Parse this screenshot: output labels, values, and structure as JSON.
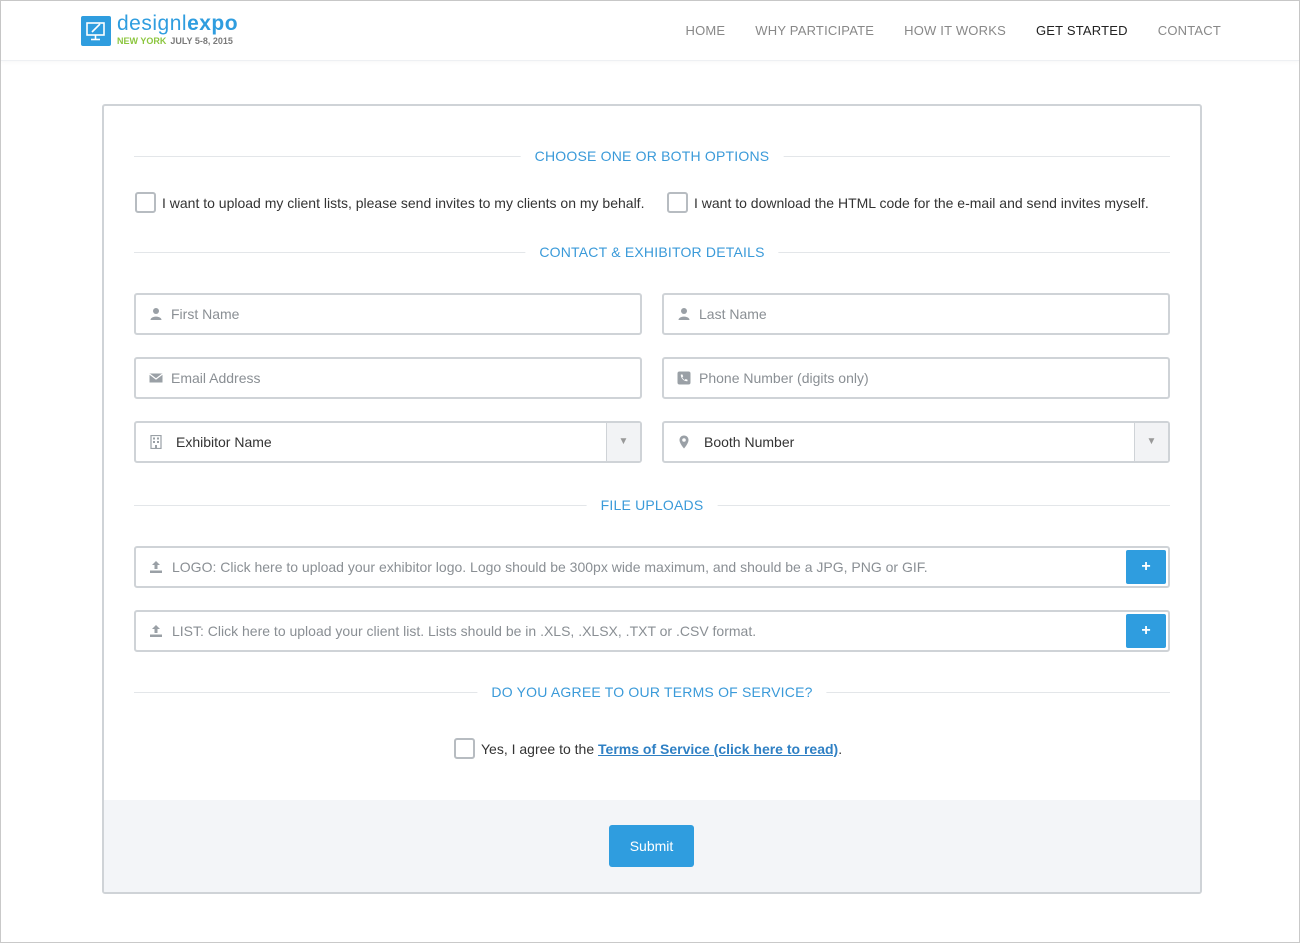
{
  "brand": {
    "name_light": "designl",
    "name_bold": "expo",
    "city": "NEW YORK",
    "dates": "JULY 5-8, 2015",
    "logo_icon": "monitor-pencil-icon",
    "accent_color": "#2f9ddf",
    "city_color": "#8cc63f"
  },
  "nav": {
    "items": [
      {
        "label": "HOME"
      },
      {
        "label": "WHY PARTICIPATE"
      },
      {
        "label": "HOW IT WORKS"
      },
      {
        "label": "GET STARTED",
        "active": true
      },
      {
        "label": "CONTACT"
      }
    ]
  },
  "sections": {
    "options": "CHOOSE ONE OR BOTH OPTIONS",
    "contact": "CONTACT & EXHIBITOR DETAILS",
    "uploads": "FILE UPLOADS",
    "terms": "DO YOU AGREE TO OUR TERMS OF SERVICE?"
  },
  "options": {
    "upload_lists": {
      "label": "I want to upload my client lists, please send invites to my clients on my behalf.",
      "checked": false
    },
    "download_html": {
      "label": "I want to download the HTML code for the e-mail and send invites myself.",
      "checked": false
    }
  },
  "fields": {
    "first_name": {
      "placeholder": "First Name",
      "icon": "user-icon",
      "value": ""
    },
    "last_name": {
      "placeholder": "Last Name",
      "icon": "user-icon",
      "value": ""
    },
    "email": {
      "placeholder": "Email Address",
      "icon": "envelope-icon",
      "value": ""
    },
    "phone": {
      "placeholder": "Phone Number (digits only)",
      "icon": "phone-icon",
      "value": ""
    },
    "exhibitor": {
      "selected": "Exhibitor Name",
      "icon": "building-icon"
    },
    "booth": {
      "selected": "Booth Number",
      "icon": "map-pin-icon"
    }
  },
  "uploads": {
    "logo": {
      "text": "LOGO: Click here to upload your exhibitor logo. Logo should be 300px wide maximum, and should be a JPG, PNG or GIF.",
      "button": "+",
      "icon": "upload-icon"
    },
    "list": {
      "text": "LIST: Click here to upload your client list. Lists should be in .XLS, .XLSX, .TXT or .CSV format.",
      "button": "+",
      "icon": "upload-icon"
    }
  },
  "terms": {
    "prefix": "Yes, I agree to the ",
    "link": "Terms of Service (click here to read)",
    "suffix": ".",
    "checked": false
  },
  "submit": {
    "label": "Submit"
  }
}
